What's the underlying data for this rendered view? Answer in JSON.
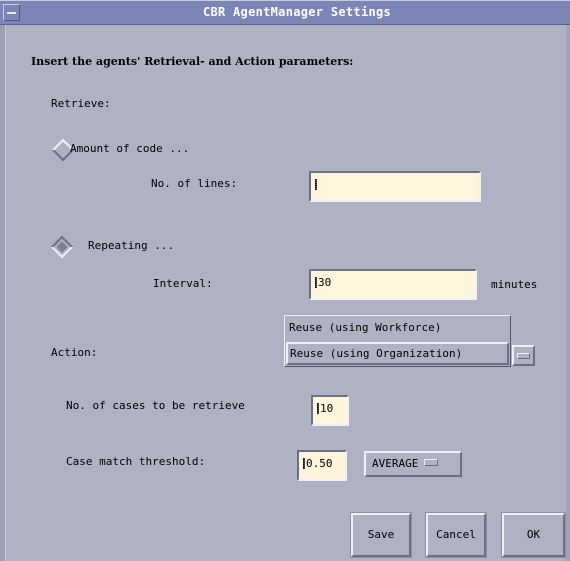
{
  "window": {
    "title": "CBR AgentManager Settings"
  },
  "form": {
    "heading": "Insert the agents' Retrieval- and  Action parameters:",
    "retrieve_label": "Retrieve:",
    "amount_option": "Amount of code ...",
    "lines_label": "No. of lines:",
    "lines_value": "",
    "repeating_option": "Repeating ...",
    "interval_label": "Interval:",
    "interval_value": "30",
    "minutes_label": "minutes",
    "action_label": "Action:",
    "action_options": [
      "Reuse (using Workforce)",
      "Reuse (using Organization)"
    ],
    "action_selected": "Reuse (using Organization)",
    "cases_label": "No. of cases to be retrieve",
    "cases_value": "10",
    "threshold_label": "Case match threshold:",
    "threshold_value": "0.50",
    "threshold_mode": "AVERAGE"
  },
  "buttons": {
    "save": "Save",
    "cancel": "Cancel",
    "ok": "OK"
  },
  "colors": {
    "background": "#aeb2c3",
    "titlebar": "#7c86b6",
    "field": "#fff4dc"
  },
  "icons": {
    "window_menu": "window-menu-icon",
    "option_indicator": "option-menu-indicator-icon"
  }
}
